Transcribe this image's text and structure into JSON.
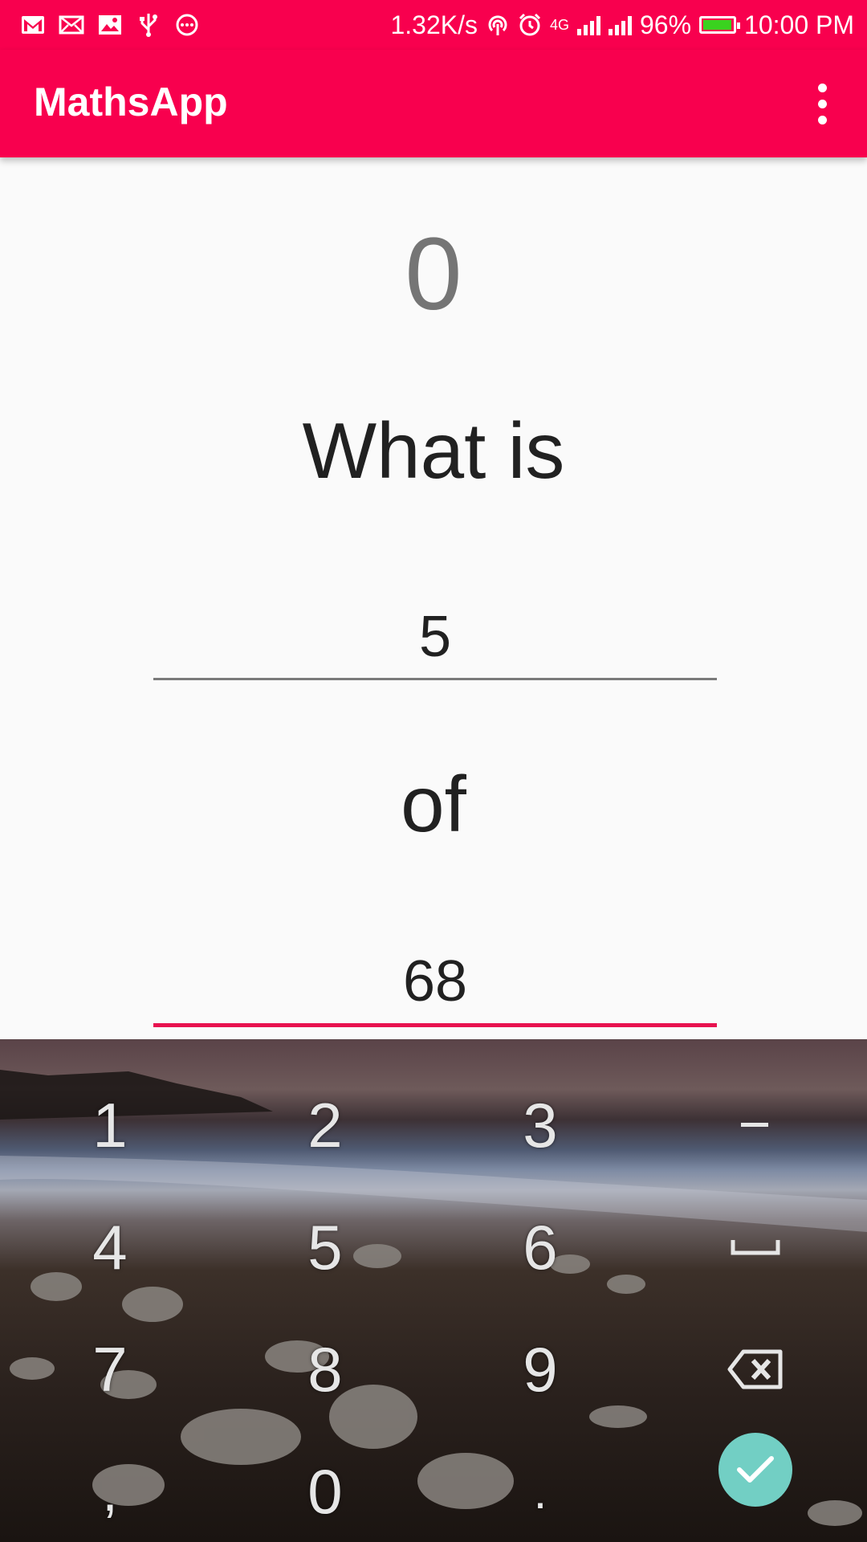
{
  "status_bar": {
    "net_speed": "1.32K/s",
    "network_type": "4G",
    "battery_percent": "96%",
    "battery_level": 0.96,
    "time": "10:00 PM",
    "left_icons": [
      "gmail-icon",
      "mail-icon",
      "image-icon",
      "usb-icon",
      "more-notifications-icon"
    ],
    "right_icons": [
      "hotspot-icon",
      "alarm-icon",
      "signal-icon",
      "signal-icon",
      "battery-icon"
    ],
    "colors": {
      "battery_fill": "#3ad21f"
    }
  },
  "app_bar": {
    "title": "MathsApp",
    "menu_icon": "overflow-menu-icon",
    "color": "#f8004e"
  },
  "main": {
    "score": "0",
    "question_label": "What is",
    "operand1": "5",
    "of_label": "of",
    "operand2": "68",
    "accent_color": "#e8124f"
  },
  "keyboard": {
    "keys": {
      "k1": "1",
      "k2": "2",
      "k3": "3",
      "k4": "4",
      "k5": "5",
      "k6": "6",
      "k7": "7",
      "k8": "8",
      "k9": "9",
      "comma": ",",
      "k0": "0",
      "dot": "."
    },
    "minus_icon": "minus-icon",
    "space_icon": "space-icon",
    "backspace_icon": "backspace-icon",
    "enter_icon": "check-icon",
    "enter_color": "#72cfc4"
  }
}
